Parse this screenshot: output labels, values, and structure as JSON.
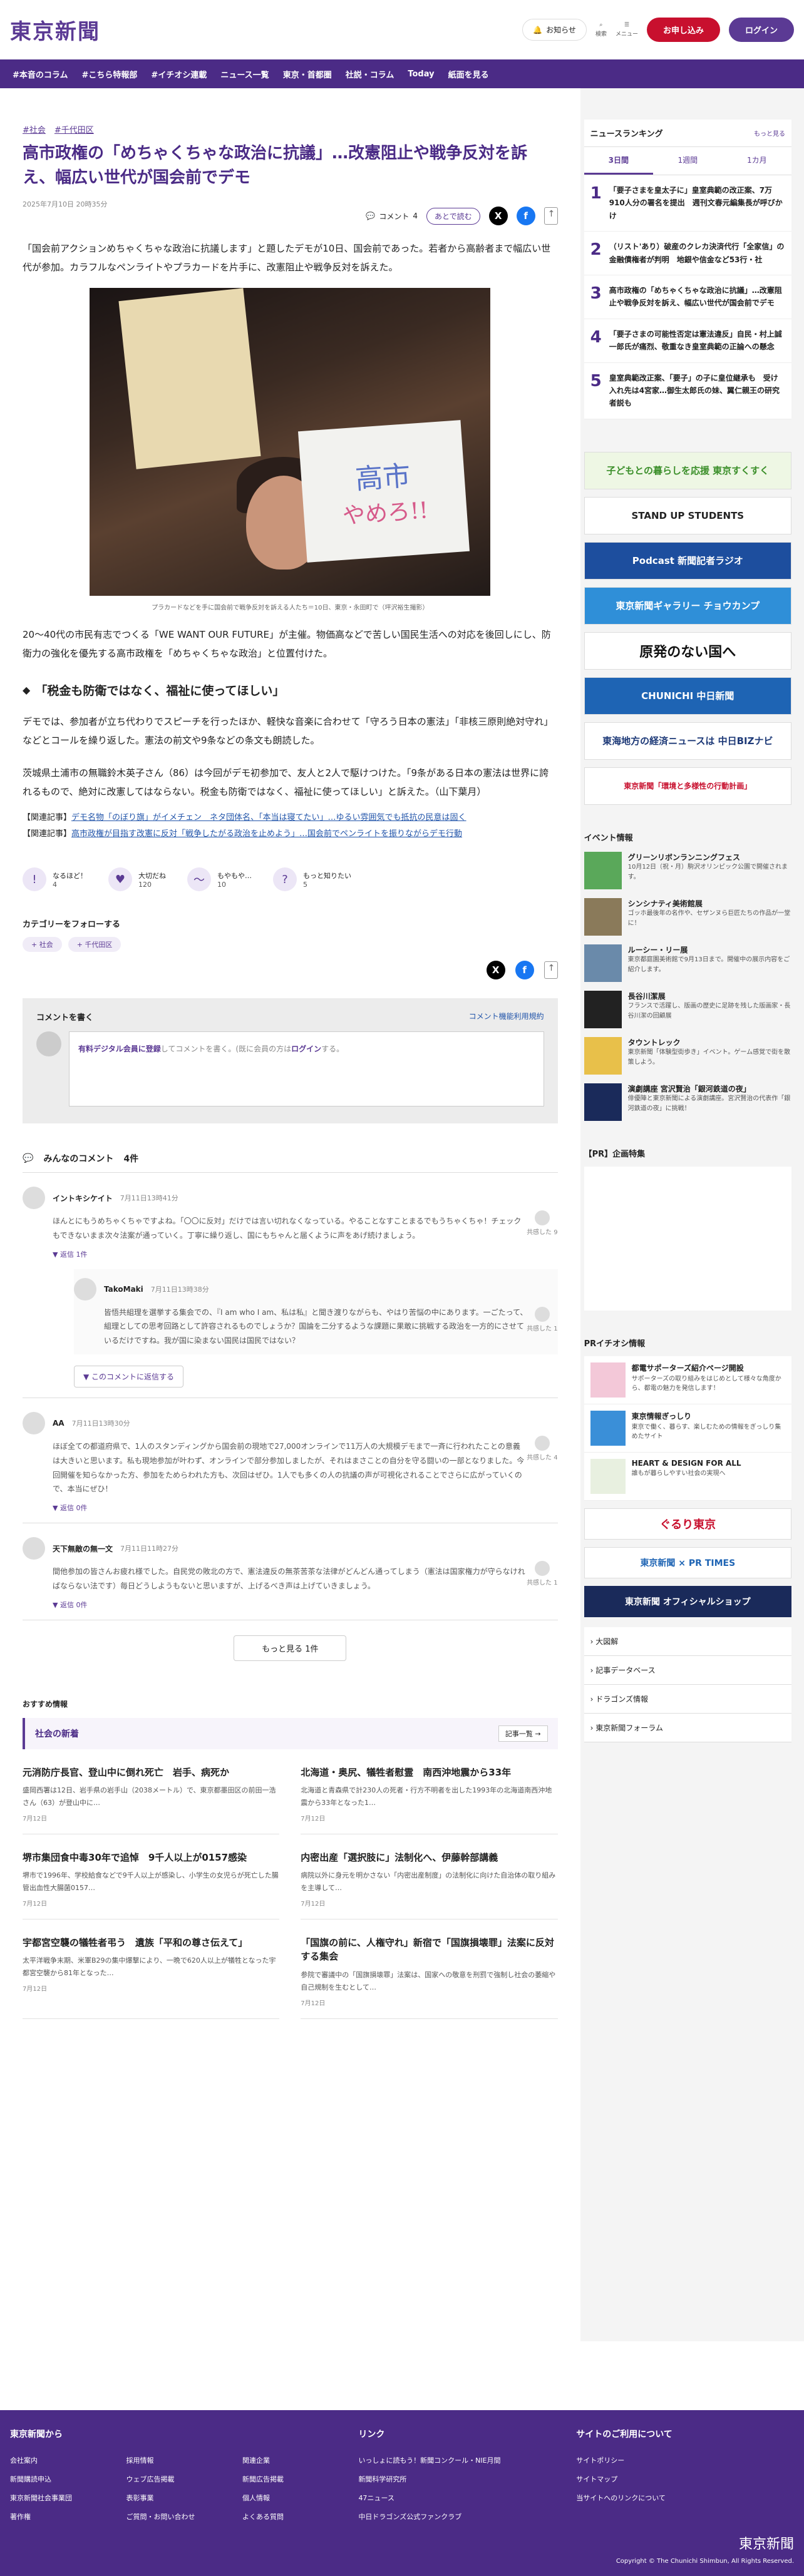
{
  "header": {
    "logo": "東京新聞",
    "notice": "お知らせ",
    "search": "検索",
    "menu": "メニュー",
    "subscribe": "お申し込み",
    "login": "ログイン"
  },
  "nav": [
    "#本音のコラム",
    "#こちら特報部",
    "#イチオシ連載",
    "ニュース一覧",
    "東京・首都圏",
    "社説・コラム",
    "Today",
    "紙面を見る"
  ],
  "article": {
    "tags": [
      "#社会",
      "#千代田区"
    ],
    "title": "高市政権の「めちゃくちゃな政治に抗議」…改憲阻止や戦争反対を訴え、幅広い世代が国会前でデモ",
    "date": "2025年7月10日 20時35分",
    "comment_label": "コメント",
    "comment_count": "4",
    "later": "あとで読む",
    "p1": "「国会前アクションめちゃくちゃな政治に抗議します」と題したデモが10日、国会前であった。若者から高齢者まで幅広い世代が参加。カラフルなペンライトやプラカードを片手に、改憲阻止や戦争反対を訴えた。",
    "photo_sign1": "高市",
    "photo_sign2": "やめろ!!",
    "caption": "プラカードなどを手に国会前で戦争反対を訴える人たち＝10日、東京・永田町で（坪沢裕生撮影）",
    "p2": "20〜40代の市民有志でつくる「WE WANT OUR FUTURE」が主催。物価高などで苦しい国民生活への対応を後回しにし、防衛力の強化を優先する高市政権を「めちゃくちゃな政治」と位置付けた。",
    "h2": "「税金も防衛ではなく、福祉に使ってほしい」",
    "p3": "デモでは、参加者が立ち代わりでスピーチを行ったほか、軽快な音楽に合わせて「守ろう日本の憲法」「非核三原則絶対守れ」などとコールを繰り返した。憲法の前文や9条などの条文も朗読した。",
    "p4": "茨城県土浦市の無職鈴木英子さん（86）は今回がデモ初参加で、友人と2人で駆けつけた。「9条がある日本の憲法は世界に誇れるもので、絶対に改憲してはならない。税金も防衛ではなく、福祉に使ってほしい」と訴えた。（山下葉月）",
    "rel1_label": "【関連記事】",
    "rel1": "デモ名物「のぼり旗」がイメチェン　ネタ団体名、「本当は寝てたい」…ゆるい雰囲気でも抵抗の民意は固く",
    "rel2_label": "【関連記事】",
    "rel2": "高市政権が目指す改憲に反対「戦争したがる政治を止めよう」…国会前でペンライトを振りながらデモ行動",
    "reactions": [
      {
        "label": "なるほど！",
        "n": "4"
      },
      {
        "label": "大切だね",
        "n": "120"
      },
      {
        "label": "もやもや…",
        "n": "10"
      },
      {
        "label": "もっと知りたい",
        "n": "5"
      }
    ],
    "follow": "カテゴリーをフォローする",
    "ftags": [
      "+ 社会",
      "+ 千代田区"
    ]
  },
  "comment_box": {
    "title": "コメントを書く",
    "rule": "コメント機能利用規約",
    "cta_strong": "有料デジタル会員に登録",
    "cta_rest": "してコメントを書く。(既に会員の方は",
    "cta_login": "ログイン",
    "cta_end": "する。"
  },
  "comments_title": "みんなのコメント",
  "comments_count": "4件",
  "comments": [
    {
      "name": "イントキシケイト",
      "time": "7月11日13時41分",
      "text": "ほんとにもうめちゃくちゃですよね。「〇〇に反対」だけでは言い切れなくなっている。やることなすことまるでもうちゃくちゃ！チェックもできないまま次々法案が通っていく。丁寧に繰り返し、国にもちゃんと届くように声をあげ続けましょう。",
      "likes": "共感した 9",
      "reply": "返信 1件"
    },
    {
      "name": "AA",
      "time": "7月11日13時30分",
      "text": "ほぼ全ての都道府県で、1人のスタンディングから国会前の現地で27,000オンラインで11万人の大規模デモまで一斉に行われたことの意義は大きいと思います。私も現地参加が叶わず、オンラインで部分参加しましたが、それはまさことの自分を守る闘いの一部となりました。今回開催を知らなかった方、参加をためらわれた方も、次回はぜひ。1人でも多くの人の抗議の声が可視化されることでさらに広がっていくので、本当にぜひ！",
      "likes": "共感した 4",
      "reply": "返信 0件"
    },
    {
      "name": "天下無敵の無一文",
      "time": "7月11日11時27分",
      "text": "間他参加の皆さんお疲れ様でした。自民党の敗北の方で、憲法違反の無茶苦茶な法律がどんどん通ってしまう（憲法は国家権力が守らなければならない法です）毎日どうしようもないと思いますが、上げるべき声は上げていきましょう。",
      "likes": "共感した 1",
      "reply": "返信 0件"
    }
  ],
  "subcomment": {
    "name": "TakoMaki",
    "time": "7月11日13時38分",
    "text": "皆悟共組理を選挙する集会での、『I am who I am、私は私』と聞き渡りながらも、やはり苦悩の中にあります。一ごたって、組理としての思考回路として許容されるものでしょうか？国論を二分するような課題に果敢に挑戦する政治を一方的にさせているだけですね。我が国に染まない国民は国民ではない？",
    "likes": "共感した 1",
    "collapse": "このコメントに返信する"
  },
  "more_btn": "もっと見る 1件",
  "rec": "おすすめ情報",
  "news": {
    "title": "社会の新着",
    "more": "記事一覧",
    "items": [
      {
        "t": "元消防庁長官、登山中に倒れ死亡　岩手、病死か",
        "d": "盛岡西署は12日、岩手県の岩手山（2038メートル）で、東京都墨田区の前田一浩さん（63）が登山中に…",
        "date": "7月12日"
      },
      {
        "t": "北海道・奥尻、犠牲者慰霊　南西沖地震から33年",
        "d": "北海道と青森県で計230人の死者・行方不明者を出した1993年の北海道南西沖地震から33年となった1…",
        "date": "7月12日"
      },
      {
        "t": "堺市集団食中毒30年で追悼　9千人以上が0157感染",
        "d": "堺市で1996年、学校給食などで9千人以上が感染し、小学生の女児らが死亡した腸管出血性大腸菌0157…",
        "date": "7月12日"
      },
      {
        "t": "内密出産「選択肢に」法制化へ、伊藤幹部講義",
        "d": "病院以外に身元を明かさない「内密出産制度」の法制化に向けた自治体の取り組みを主導して…",
        "date": "7月12日"
      },
      {
        "t": "宇都宮空襲の犠牲者弔う　遺族「平和の尊さ伝えて」",
        "d": "太平洋戦争末期、米軍B29の集中爆撃により、一晩で620人以上が犠牲となった宇都宮空襲から81年となった…",
        "date": "7月12日"
      },
      {
        "t": "「国旗の前に、人権守れ」新宿で「国旗損壊罪」法案に反対する集会",
        "d": "参院で審議中の「国旗損壊罪」法案は、国家への敬意を刑罰で強制し社会の萎縮や自己規制を生むとして…",
        "date": "7月12日"
      }
    ]
  },
  "ranking": {
    "title": "ニュースランキング",
    "more": "もっと見る",
    "tabs": [
      "3日間",
      "1週間",
      "1カ月"
    ],
    "items": [
      {
        "n": "1",
        "t": "「要子さまを皇太子に」皇室典範の改正案、7万910人分の署名を提出　週刊文春元編集長が呼びかけ"
      },
      {
        "n": "2",
        "t": "（リスト'あり）破産のクレカ決済代行「全家信」の金融債権者が判明　地銀や信金など53行・社"
      },
      {
        "n": "3",
        "t": "高市政権の「めちゃくちゃな政治に抗議」…改憲阻止や戦争反対を訴え、幅広い世代が国会前でデモ"
      },
      {
        "n": "4",
        "t": "「要子さまの可能性否定は憲法違反」自民・村上誠一郎氏が痛烈、敬重なき皇室典範の正論への懸念"
      },
      {
        "n": "5",
        "t": "皇室典範改正案、「要子」の子に皇位継承も　受け入れ先は4宮家…御生太郎氏の妹、翼仁親王の研究者説も"
      }
    ]
  },
  "banners": [
    "子どもとの暮らしを応援 東京すくすく",
    "STAND UP STUDENTS",
    "Podcast 新聞記者ラジオ",
    "東京新聞ギャラリー チョウカンプ",
    "原発のない国へ",
    "CHUNICHI 中日新聞",
    "東海地方の経済ニュースは 中日BIZナビ",
    "東京新聞「環境と多様性の行動計画」"
  ],
  "events_title": "イベント情報",
  "events": [
    {
      "t": "グリーンリボンランニングフェス",
      "d": "10月12日（祝・月）駒沢オリンピック公園で開催されます。"
    },
    {
      "t": "シンシナティ美術館展",
      "d": "ゴッホ最後年の名作や、セザンヌら巨匠たちの作品が一堂に！"
    },
    {
      "t": "ルーシー・リー展",
      "d": "東京都庭園美術館で9月13日まで。開催中の展示内容をご紹介します。"
    },
    {
      "t": "長谷川潔展",
      "d": "フランスで活躍し、版画の歴史に足跡を残した版画家・長谷川潔の回顧展"
    },
    {
      "t": "タウントレック",
      "d": "東京新聞「体験型街歩き」イベント。ゲーム感覚で街を散策しよう。"
    },
    {
      "t": "演劇講座 宮沢賢治「銀河鉄道の夜」",
      "d": "俳優陣と東京新聞による演劇講座。宮沢賢治の代表作「銀河鉄道の夜」に挑戦！"
    }
  ],
  "pr_title": "【PR】企画特集",
  "pri_title": "PRイチオシ情報",
  "pri": [
    {
      "t": "都電サポーターズ紹介ページ開設",
      "d": "サポーターズの取り組みをはじめとして様々な角度から、都電の魅力を発信します！"
    },
    {
      "t": "東京情報ぎっしり",
      "d": "東京で働く、暮らす、楽しむための情報をぎっしり集めたサイト"
    },
    {
      "t": "HEART & DESIGN FOR ALL",
      "d": "誰もが暮らしやすい社会の実現へ"
    }
  ],
  "bigbtns": [
    "ぐるり東京",
    "東京新聞 × PR TIMES",
    "東京新聞 オフィシャルショップ"
  ],
  "links": [
    "大図解",
    "記事データベース",
    "ドラゴンズ情報",
    "東京新聞フォーラム"
  ],
  "footer": {
    "c1": "東京新聞から",
    "c2": "リンク",
    "c3": "サイトのご利用について",
    "l1": [
      "会社案内",
      "採用情報",
      "関連企業",
      "新聞購読申込",
      "ウェブ広告掲載",
      "新聞広告掲載",
      "東京新聞社会事業団",
      "表彰事業",
      "個人情報",
      "著作権",
      "ご質問・お問い合わせ",
      "よくある質問"
    ],
    "l2": [
      "いっしょに読もう！新聞コンクール・NIE月間",
      "新聞科学研究所",
      "47ニュース",
      "中日ドラゴンズ公式ファンクラブ"
    ],
    "l3": [
      "サイトポリシー",
      "サイトマップ",
      "当サイトへのリンクについて"
    ],
    "logo": "東京新聞",
    "copy": "Copyright © The Chunichi Shimbun, All Rights Reserved."
  }
}
